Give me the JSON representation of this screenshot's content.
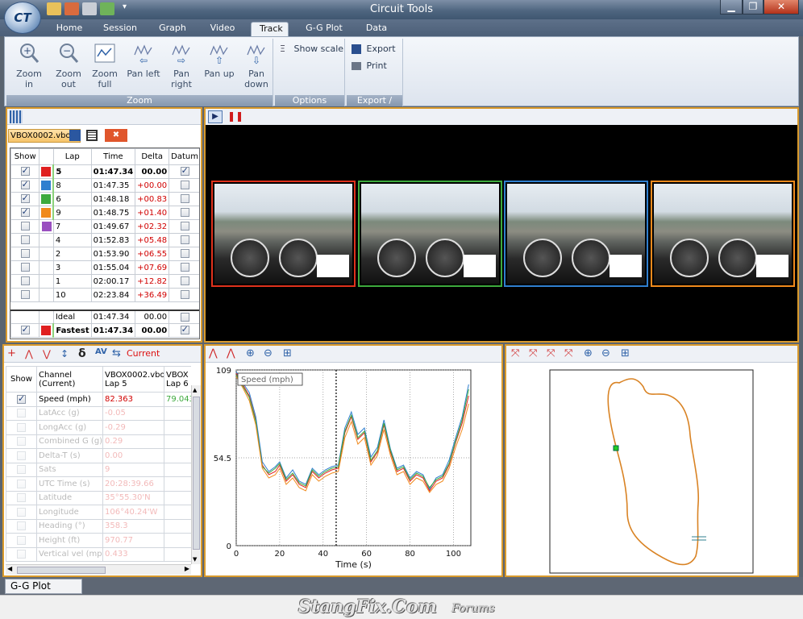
{
  "window": {
    "title": "Circuit Tools"
  },
  "tabs": [
    "Home",
    "Session",
    "Graph",
    "Video",
    "Track",
    "G-G Plot",
    "Data"
  ],
  "active_tab": "Track",
  "ribbon": {
    "zoom": {
      "label": "Zoom",
      "buttons": [
        {
          "label": "Zoom in",
          "icon": "zoom-in-icon"
        },
        {
          "label": "Zoom out",
          "icon": "zoom-out-icon"
        },
        {
          "label": "Zoom full",
          "icon": "zoom-full-icon"
        },
        {
          "label": "Pan left",
          "icon": "pan-left-icon"
        },
        {
          "label": "Pan right",
          "icon": "pan-right-icon"
        },
        {
          "label": "Pan up",
          "icon": "pan-up-icon"
        },
        {
          "label": "Pan down",
          "icon": "pan-down-icon"
        }
      ]
    },
    "options": {
      "label": "Options",
      "show_scale": "Show scale"
    },
    "export": {
      "label": "Export / Print",
      "export": "Export",
      "print": "Print"
    }
  },
  "file_tab": "VBOX0002.vbo",
  "lap_table": {
    "headers": [
      "Show",
      "",
      "Lap",
      "Time",
      "Delta",
      "Datum"
    ],
    "rows": [
      {
        "show": true,
        "color": "#e02020",
        "lap": "5",
        "time": "01:47.34",
        "delta": "00.00",
        "datum": true,
        "bold": true
      },
      {
        "show": true,
        "color": "#2f7fcf",
        "lap": "8",
        "time": "01:47.35",
        "delta": "+00.00",
        "datum": false,
        "bold": false
      },
      {
        "show": true,
        "color": "#3daa3d",
        "lap": "6",
        "time": "01:48.18",
        "delta": "+00.83",
        "datum": false,
        "bold": false
      },
      {
        "show": true,
        "color": "#f08a1c",
        "lap": "9",
        "time": "01:48.75",
        "delta": "+01.40",
        "datum": false,
        "bold": false
      },
      {
        "show": false,
        "color": "#9a4fc0",
        "lap": "7",
        "time": "01:49.67",
        "delta": "+02.32",
        "datum": false,
        "bold": false
      },
      {
        "show": false,
        "color": "",
        "lap": "4",
        "time": "01:52.83",
        "delta": "+05.48",
        "datum": false,
        "bold": false
      },
      {
        "show": false,
        "color": "",
        "lap": "2",
        "time": "01:53.90",
        "delta": "+06.55",
        "datum": false,
        "bold": false
      },
      {
        "show": false,
        "color": "",
        "lap": "3",
        "time": "01:55.04",
        "delta": "+07.69",
        "datum": false,
        "bold": false
      },
      {
        "show": false,
        "color": "",
        "lap": "1",
        "time": "02:00.17",
        "delta": "+12.82",
        "datum": false,
        "bold": false
      },
      {
        "show": false,
        "color": "",
        "lap": "10",
        "time": "02:23.84",
        "delta": "+36.49",
        "datum": false,
        "bold": false
      }
    ],
    "ideal": {
      "lap": "Ideal",
      "time": "01:47.34",
      "delta": "00.00"
    },
    "fastest": {
      "lap": "Fastest",
      "time": "01:47.34",
      "delta": "00.00"
    }
  },
  "video": {
    "thumb_colors": [
      "#e0321c",
      "#3daa3d",
      "#2f7fcf",
      "#f08a1c"
    ]
  },
  "channel_panel": {
    "current_label": "Current",
    "headers": [
      "Show",
      "Channel (Current)",
      "VBOX0002.vbo Lap 5",
      "VBOX Lap 6"
    ],
    "rows": [
      {
        "show": true,
        "name": "Speed (mph)",
        "v1": "82.363",
        "v2": "79.043",
        "faded": false
      },
      {
        "show": false,
        "name": "LatAcc (g)",
        "v1": "-0.05",
        "v2": "",
        "faded": true
      },
      {
        "show": false,
        "name": "LongAcc (g)",
        "v1": "-0.29",
        "v2": "",
        "faded": true
      },
      {
        "show": false,
        "name": "Combined G (g)",
        "v1": "0.29",
        "v2": "",
        "faded": true
      },
      {
        "show": false,
        "name": "Delta-T (s)",
        "v1": "0.00",
        "v2": "",
        "faded": true
      },
      {
        "show": false,
        "name": "Sats",
        "v1": "9",
        "v2": "",
        "faded": true
      },
      {
        "show": false,
        "name": "UTC Time (s)",
        "v1": "20:28:39.66",
        "v2": "",
        "faded": true
      },
      {
        "show": false,
        "name": "Latitude",
        "v1": "35°55.30'N",
        "v2": "",
        "faded": true
      },
      {
        "show": false,
        "name": "Longitude",
        "v1": "106°40.24'W",
        "v2": "",
        "faded": true
      },
      {
        "show": false,
        "name": "Heading (°)",
        "v1": "358.3",
        "v2": "",
        "faded": true
      },
      {
        "show": false,
        "name": "Height (ft)",
        "v1": "970.77",
        "v2": "",
        "faded": true
      },
      {
        "show": false,
        "name": "Vertical vel (mph)",
        "v1": "0.433",
        "v2": "",
        "faded": true
      }
    ]
  },
  "bottom_tab": "G-G Plot",
  "watermark": {
    "main": "StangFix.Com",
    "small": "Forums"
  },
  "chart_data": {
    "type": "line",
    "title": "Speed (mph)",
    "xlabel": "Time (s)",
    "ylabel": "",
    "xlim": [
      0,
      108
    ],
    "ylim": [
      0,
      109
    ],
    "yticks": [
      "0",
      "54.5",
      "109"
    ],
    "xticks": [
      "0",
      "20",
      "40",
      "60",
      "80",
      "100"
    ],
    "series": [
      {
        "color": "#e02020",
        "x": [
          0,
          3,
          6,
          9,
          12,
          15,
          18,
          20,
          23,
          26,
          29,
          32,
          35,
          38,
          41,
          44,
          47,
          50,
          53,
          56,
          59,
          62,
          65,
          68,
          71,
          74,
          77,
          80,
          83,
          86,
          89,
          92,
          95,
          98,
          101,
          104,
          107
        ],
        "y": [
          107,
          100,
          93,
          78,
          50,
          44,
          46,
          50,
          40,
          44,
          38,
          36,
          46,
          42,
          45,
          47,
          48,
          70,
          80,
          66,
          70,
          52,
          58,
          75,
          58,
          46,
          48,
          40,
          44,
          42,
          34,
          40,
          42,
          50,
          64,
          76,
          93
        ]
      },
      {
        "color": "#2f7fcf",
        "x": [
          0,
          3,
          6,
          9,
          12,
          15,
          18,
          20,
          23,
          26,
          29,
          32,
          35,
          38,
          41,
          44,
          47,
          50,
          53,
          56,
          59,
          62,
          65,
          68,
          71,
          74,
          77,
          80,
          83,
          86,
          89,
          92,
          95,
          98,
          101,
          104,
          107
        ],
        "y": [
          108,
          101,
          95,
          80,
          52,
          46,
          49,
          52,
          42,
          47,
          40,
          38,
          48,
          44,
          47,
          49,
          50,
          73,
          83,
          69,
          73,
          55,
          61,
          78,
          60,
          48,
          50,
          42,
          46,
          44,
          35,
          42,
          44,
          53,
          67,
          80,
          100
        ]
      },
      {
        "color": "#3daa3d",
        "x": [
          0,
          3,
          6,
          9,
          12,
          15,
          18,
          20,
          23,
          26,
          29,
          32,
          35,
          38,
          41,
          44,
          47,
          50,
          53,
          56,
          59,
          62,
          65,
          68,
          71,
          74,
          77,
          80,
          83,
          86,
          89,
          92,
          95,
          98,
          101,
          104,
          107
        ],
        "y": [
          106,
          99,
          92,
          77,
          49,
          45,
          48,
          51,
          41,
          45,
          39,
          37,
          47,
          43,
          46,
          48,
          49,
          71,
          81,
          67,
          71,
          53,
          59,
          76,
          59,
          47,
          49,
          41,
          45,
          43,
          36,
          41,
          43,
          51,
          65,
          78,
          97
        ]
      },
      {
        "color": "#f08a1c",
        "x": [
          0,
          3,
          6,
          9,
          12,
          15,
          18,
          20,
          23,
          26,
          29,
          32,
          35,
          38,
          41,
          44,
          47,
          50,
          53,
          56,
          59,
          62,
          65,
          68,
          71,
          74,
          77,
          80,
          83,
          86,
          89,
          92,
          95,
          98,
          101,
          104,
          107
        ],
        "y": [
          105,
          98,
          90,
          75,
          48,
          42,
          44,
          48,
          38,
          42,
          36,
          34,
          44,
          40,
          43,
          45,
          46,
          67,
          77,
          63,
          67,
          50,
          56,
          72,
          56,
          44,
          46,
          38,
          42,
          40,
          33,
          38,
          40,
          48,
          61,
          72,
          88
        ]
      }
    ],
    "cursor_x": 46,
    "grid": true
  }
}
